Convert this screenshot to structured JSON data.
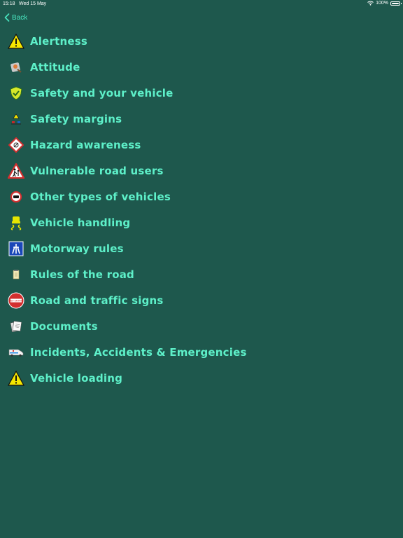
{
  "status_bar": {
    "time": "15:18",
    "date": "Wed 15 May",
    "battery": "100%",
    "battery_level": 1.0
  },
  "nav": {
    "back_label": "Back"
  },
  "colors": {
    "background": "#1e584d",
    "accent": "#49e6c0",
    "item_text": "#5ef0c9"
  },
  "topics": [
    {
      "label": "Alertness",
      "icon": "warning-triangle-icon"
    },
    {
      "label": "Attitude",
      "icon": "attitude-icon"
    },
    {
      "label": "Safety and your vehicle",
      "icon": "shield-icon"
    },
    {
      "label": "Safety margins",
      "icon": "car-distance-icon"
    },
    {
      "label": "Hazard awareness",
      "icon": "hazard-diamond-icon"
    },
    {
      "label": "Vulnerable road users",
      "icon": "pedestrian-sign-icon"
    },
    {
      "label": "Other types of vehicles",
      "icon": "vehicle-sign-icon"
    },
    {
      "label": "Vehicle handling",
      "icon": "skid-icon"
    },
    {
      "label": "Motorway rules",
      "icon": "motorway-sign-icon"
    },
    {
      "label": "Rules of the road",
      "icon": "rulebook-icon"
    },
    {
      "label": "Road and traffic signs",
      "icon": "no-entry-sign-icon"
    },
    {
      "label": "Documents",
      "icon": "documents-icon"
    },
    {
      "label": "Incidents, Accidents & Emergencies",
      "icon": "ambulance-icon"
    },
    {
      "label": "Vehicle loading",
      "icon": "warning-triangle-icon"
    }
  ]
}
